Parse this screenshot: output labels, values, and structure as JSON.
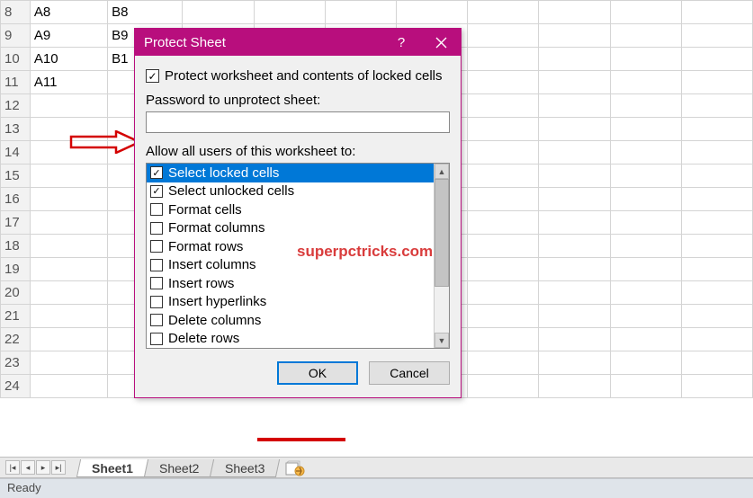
{
  "grid": {
    "rows": [
      {
        "n": "8",
        "a": "A8",
        "b": "B8"
      },
      {
        "n": "9",
        "a": "A9",
        "b": "B9"
      },
      {
        "n": "10",
        "a": "A10",
        "b": "B1"
      },
      {
        "n": "11",
        "a": "A11",
        "b": ""
      },
      {
        "n": "12",
        "a": "",
        "b": ""
      },
      {
        "n": "13",
        "a": "",
        "b": ""
      },
      {
        "n": "14",
        "a": "",
        "b": ""
      },
      {
        "n": "15",
        "a": "",
        "b": ""
      },
      {
        "n": "16",
        "a": "",
        "b": ""
      },
      {
        "n": "17",
        "a": "",
        "b": ""
      },
      {
        "n": "18",
        "a": "",
        "b": ""
      },
      {
        "n": "19",
        "a": "",
        "b": ""
      },
      {
        "n": "20",
        "a": "",
        "b": ""
      },
      {
        "n": "21",
        "a": "",
        "b": ""
      },
      {
        "n": "22",
        "a": "",
        "b": ""
      },
      {
        "n": "23",
        "a": "",
        "b": ""
      },
      {
        "n": "24",
        "a": "",
        "b": ""
      }
    ]
  },
  "dialog": {
    "title": "Protect Sheet",
    "help": "?",
    "protect_label": "Protect worksheet and contents of locked cells",
    "password_label": "Password to unprotect sheet:",
    "password_value": "",
    "allow_label": "Allow all users of this worksheet to:",
    "options": [
      {
        "label": "Select locked cells",
        "checked": true,
        "selected": true
      },
      {
        "label": "Select unlocked cells",
        "checked": true,
        "selected": false
      },
      {
        "label": "Format cells",
        "checked": false,
        "selected": false
      },
      {
        "label": "Format columns",
        "checked": false,
        "selected": false
      },
      {
        "label": "Format rows",
        "checked": false,
        "selected": false
      },
      {
        "label": "Insert columns",
        "checked": false,
        "selected": false
      },
      {
        "label": "Insert rows",
        "checked": false,
        "selected": false
      },
      {
        "label": "Insert hyperlinks",
        "checked": false,
        "selected": false
      },
      {
        "label": "Delete columns",
        "checked": false,
        "selected": false
      },
      {
        "label": "Delete rows",
        "checked": false,
        "selected": false
      }
    ],
    "ok": "OK",
    "cancel": "Cancel"
  },
  "watermark": "superpctricks.com",
  "tabs": {
    "items": [
      "Sheet1",
      "Sheet2",
      "Sheet3"
    ],
    "active": 0
  },
  "status": "Ready"
}
